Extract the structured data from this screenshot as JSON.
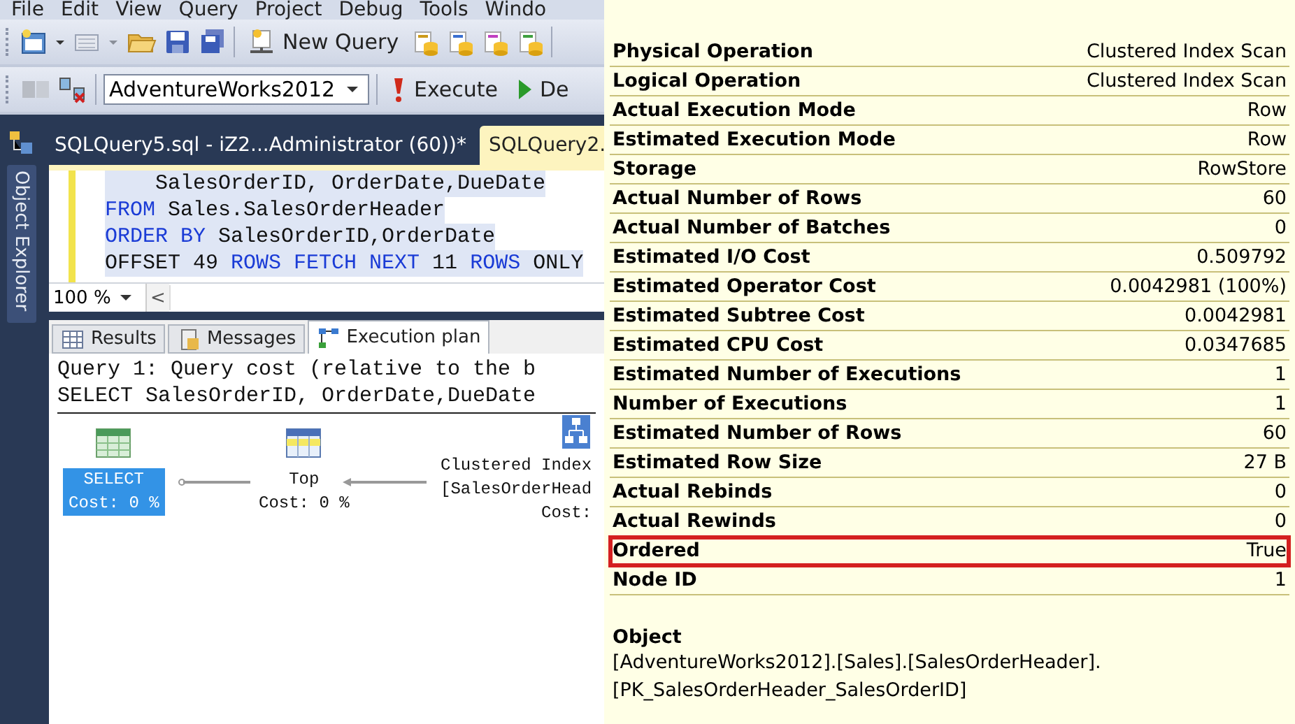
{
  "menu": [
    "File",
    "Edit",
    "View",
    "Query",
    "Project",
    "Debug",
    "Tools",
    "Windo"
  ],
  "toolbar": {
    "new_query": "New Query"
  },
  "query_toolbar": {
    "database": "AdventureWorks2012",
    "execute": "Execute",
    "debug": "De"
  },
  "side_panel": {
    "label": "Object Explorer"
  },
  "document_tabs": [
    {
      "label": "SQLQuery5.sql - iZ2...Administrator (60))*",
      "selected": false
    },
    {
      "label": "SQLQuery2.",
      "selected": true
    }
  ],
  "editor": {
    "lines": [
      [
        {
          "text": "    SalesOrderID, OrderDate,DueDate",
          "kind": "plain"
        }
      ],
      [
        {
          "text": "FROM",
          "kind": "keyword"
        },
        {
          "text": " Sales.SalesOrderHeader",
          "kind": "plain"
        }
      ],
      [
        {
          "text": "ORDER BY",
          "kind": "keyword"
        },
        {
          "text": " SalesOrderID,OrderDate",
          "kind": "plain"
        }
      ],
      [
        {
          "text": "OFFSET 49 ",
          "kind": "plain"
        },
        {
          "text": "ROWS FETCH NEXT",
          "kind": "keyword"
        },
        {
          "text": " 11 ",
          "kind": "plain"
        },
        {
          "text": "ROWS",
          "kind": "keyword"
        },
        {
          "text": " ONLY",
          "kind": "plain"
        }
      ]
    ],
    "zoom": "100 %",
    "scroll": "<"
  },
  "result_tabs": [
    {
      "label": "Results",
      "kind": "grid",
      "selected": false
    },
    {
      "label": "Messages",
      "kind": "messages",
      "selected": false
    },
    {
      "label": "Execution plan",
      "kind": "plan",
      "selected": true
    }
  ],
  "plan": {
    "header": [
      "Query 1: Query cost (relative to the b",
      "SELECT SalesOrderID, OrderDate,DueDate"
    ],
    "nodes": [
      {
        "kind": "select",
        "lines": [
          "SELECT",
          "Cost: 0 %"
        ],
        "selected": true
      },
      {
        "kind": "top",
        "lines": [
          "Top",
          "Cost: 0 %"
        ],
        "selected": false
      },
      {
        "kind": "scan",
        "lines": [
          "Clustered Index",
          "[SalesOrderHead",
          "Cost:"
        ],
        "selected": false
      }
    ]
  },
  "tooltip": {
    "rows": [
      {
        "label": "Physical Operation",
        "value": "Clustered Index Scan",
        "highlighted": false
      },
      {
        "label": "Logical Operation",
        "value": "Clustered Index Scan",
        "highlighted": false
      },
      {
        "label": "Actual Execution Mode",
        "value": "Row",
        "highlighted": false
      },
      {
        "label": "Estimated Execution Mode",
        "value": "Row",
        "highlighted": false
      },
      {
        "label": "Storage",
        "value": "RowStore",
        "highlighted": false
      },
      {
        "label": "Actual Number of Rows",
        "value": "60",
        "highlighted": false
      },
      {
        "label": "Actual Number of Batches",
        "value": "0",
        "highlighted": false
      },
      {
        "label": "Estimated I/O Cost",
        "value": "0.509792",
        "highlighted": false
      },
      {
        "label": "Estimated Operator Cost",
        "value": "0.0042981 (100%)",
        "highlighted": false
      },
      {
        "label": "Estimated Subtree Cost",
        "value": "0.0042981",
        "highlighted": false
      },
      {
        "label": "Estimated CPU Cost",
        "value": "0.0347685",
        "highlighted": false
      },
      {
        "label": "Estimated Number of Executions",
        "value": "1",
        "highlighted": false
      },
      {
        "label": "Number of Executions",
        "value": "1",
        "highlighted": false
      },
      {
        "label": "Estimated Number of Rows",
        "value": "60",
        "highlighted": false
      },
      {
        "label": "Estimated Row Size",
        "value": "27 B",
        "highlighted": false
      },
      {
        "label": "Actual Rebinds",
        "value": "0",
        "highlighted": false
      },
      {
        "label": "Actual Rewinds",
        "value": "0",
        "highlighted": false
      },
      {
        "label": "Ordered",
        "value": "True",
        "highlighted": true
      },
      {
        "label": "Node ID",
        "value": "1",
        "highlighted": false
      }
    ],
    "object": {
      "label": "Object",
      "lines": [
        "[AdventureWorks2012].[Sales].[SalesOrderHeader].",
        "[PK_SalesOrderHeader_SalesOrderID]"
      ]
    }
  }
}
